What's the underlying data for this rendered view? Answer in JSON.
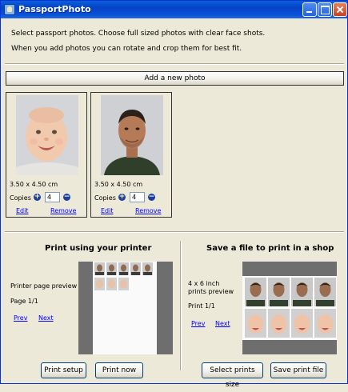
{
  "window": {
    "title": "PassportPhoto"
  },
  "instructions": {
    "line1": "Select passport photos. Choose full sized photos with clear face shots.",
    "line2": "When you add photos you can rotate and crop them for best fit."
  },
  "add_photo_label": "Add a new photo",
  "photos": [
    {
      "subject": "baby",
      "size": "3.50 x 4.50 cm",
      "copies_label": "Copies",
      "copies": "4",
      "edit_label": "Edit",
      "remove_label": "Remove"
    },
    {
      "subject": "man",
      "size": "3.50 x 4.50 cm",
      "copies_label": "Copies",
      "copies": "4",
      "edit_label": "Edit",
      "remove_label": "Remove"
    }
  ],
  "printer_section": {
    "title": "Print using your printer",
    "preview_label": "Printer page preview",
    "page": "Page 1/1",
    "prev": "Prev",
    "next": "Next",
    "setup_label": "Print setup",
    "print_now_label": "Print now"
  },
  "shop_section": {
    "title": "Save a file to print in a shop",
    "preview_label_1": "4 x 6 inch",
    "preview_label_2": "prints preview",
    "print": "Print 1/1",
    "prev": "Prev",
    "next": "Next",
    "select_size_label": "Select prints size",
    "save_label": "Save print file"
  },
  "colors": {
    "titlebar": "#0a52d8",
    "window_bg": "#ece9d8",
    "link": "#0000ff",
    "preview_bg": "#6e6e6e"
  }
}
